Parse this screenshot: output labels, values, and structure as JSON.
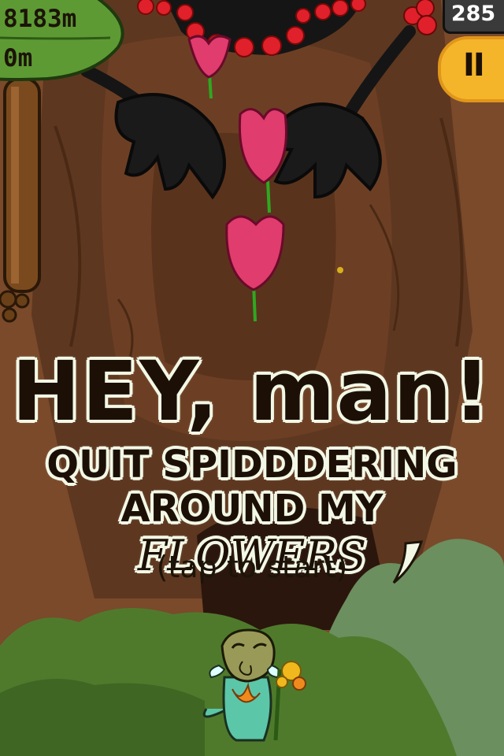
{
  "hud": {
    "distance_best": "8183m",
    "distance_current": "0m",
    "berry_count": "285",
    "pause_label": "II"
  },
  "splash": {
    "headline": "HEY, man!",
    "line2": "QUIT SPIDDDERING",
    "line3_prefix": "AROUND MY",
    "line3_emph": "FLOWERS",
    "prompt": "(tap to start)"
  },
  "icons": {
    "berries": "berries-icon",
    "pause": "pause-icon",
    "leaf": "leaf-icon"
  },
  "colors": {
    "background": "#6b4226",
    "leaf": "#5d9a34",
    "berry": "#e0202a",
    "pause_button": "#f5b52a",
    "foreground_bush": "#4f7a2c",
    "bush_light": "#6b8f5e",
    "title_fill": "#1c1006",
    "title_outline": "#f3f8e6",
    "flower": "#e03c6e"
  }
}
